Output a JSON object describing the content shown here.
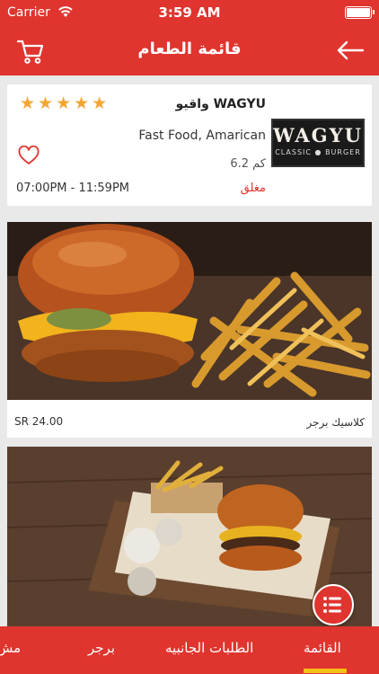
{
  "status_bar": {
    "carrier": "Carrier",
    "time": "3:59 AM"
  },
  "nav": {
    "title": "قائمة الطعام"
  },
  "restaurant": {
    "name": "واقيو WAGYU",
    "rating": 5,
    "stars": "★★★★★",
    "cuisine": "Fast Food, Amarican",
    "distance": "6.2 كم",
    "hours": "07:00PM - 11:59PM",
    "status": "مغلق",
    "logo_main": "WAGYU",
    "logo_sub": "CLASSIC ● BURGER"
  },
  "products": [
    {
      "price": "SR 24.00",
      "name": "كلاسيك برجر"
    },
    {
      "price": "",
      "name": ""
    }
  ],
  "tabs": [
    {
      "label": "القائمة",
      "active": true
    },
    {
      "label": "الطلبات الجانبيه",
      "active": false
    },
    {
      "label": "برجر",
      "active": false
    },
    {
      "label": "مش",
      "active": false
    }
  ],
  "colors": {
    "brand_red": "#e0342e",
    "star": "#f3a532",
    "tab_indicator": "#f5c118"
  }
}
